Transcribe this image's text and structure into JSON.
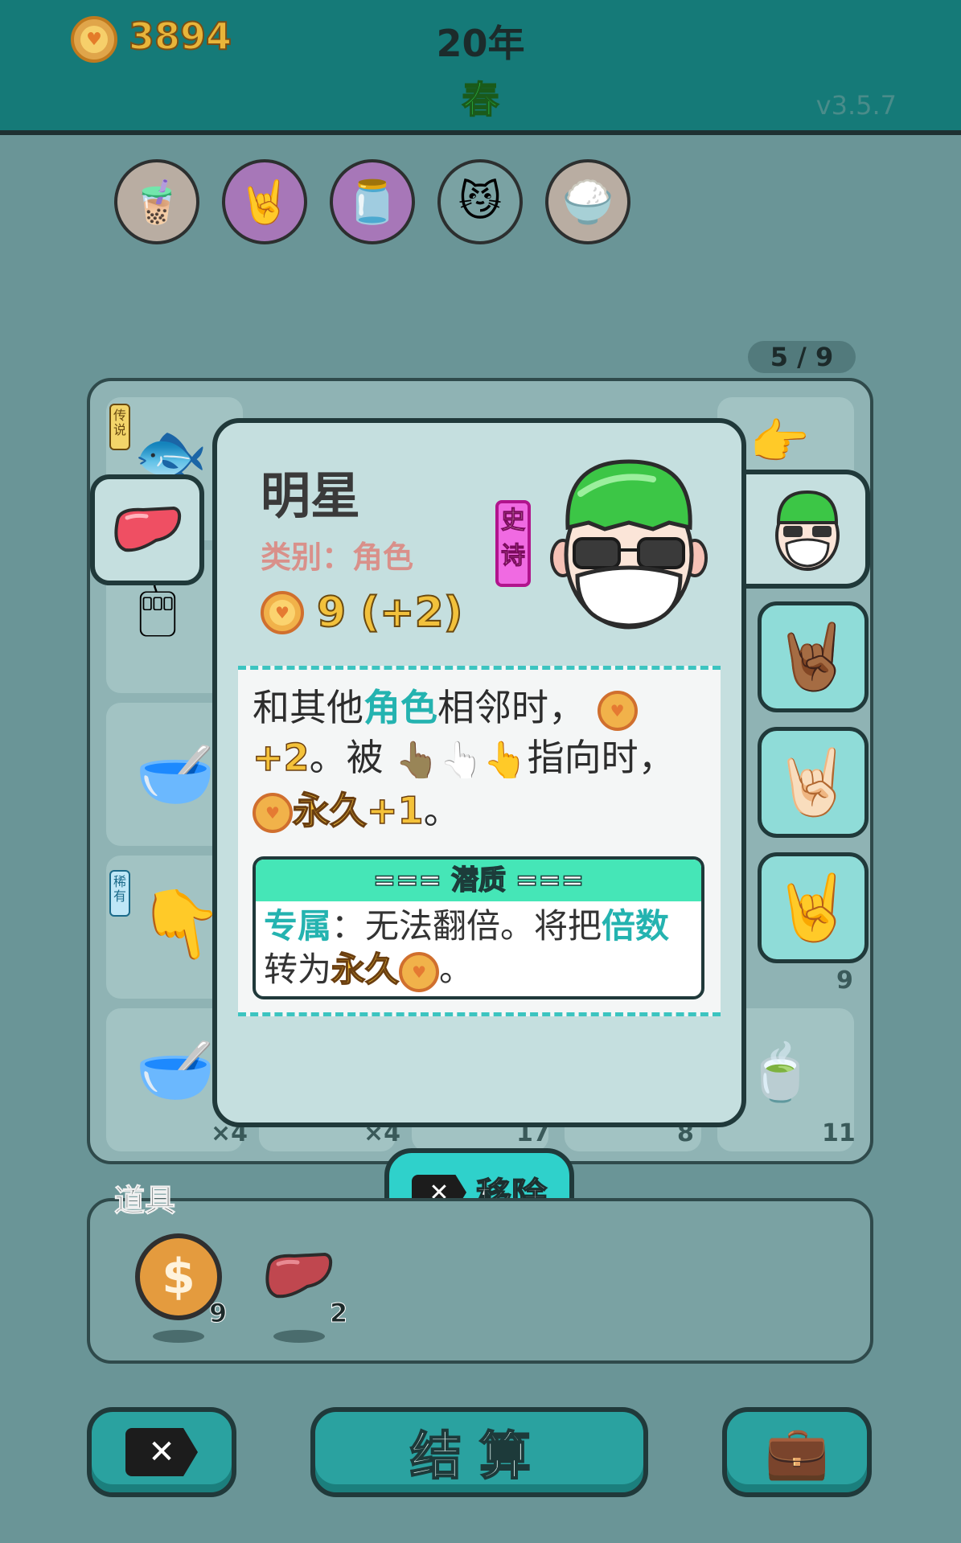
{
  "header": {
    "gold": "3894",
    "year": "20年",
    "season": "春",
    "version": "v3.5.7"
  },
  "relics": [
    {
      "icon": "bubble-tea-icon"
    },
    {
      "icon": "rock-hand-icon"
    },
    {
      "icon": "jar-icon"
    },
    {
      "icon": "cat-sunglasses-icon"
    },
    {
      "icon": "rice-bowl-icon"
    }
  ],
  "board": {
    "page": "5 / 9",
    "counts": [
      "×4",
      "×4",
      "17",
      "8",
      "11",
      "9"
    ],
    "rarity_legend": "传说",
    "rarity_rare": "稀有"
  },
  "card": {
    "title": "明星",
    "category": "类别：角色",
    "value": "9 (+2)",
    "rarity": "史诗",
    "desc_part1": "和其他",
    "desc_kw1": "角色",
    "desc_part2": "相邻时，",
    "desc_kw2": "+2",
    "desc_part3": "。被",
    "desc_part4": "指向时，",
    "desc_kw3": "永久+1",
    "desc_part5": "。",
    "trait_title": "=== 潜质 ===",
    "trait_kw1": "专属",
    "trait_part1": "：无法翻倍。将把",
    "trait_kw2": "倍数",
    "trait_part2": "转为",
    "trait_kw3": "永久",
    "trait_part3": "。"
  },
  "actions": {
    "remove": "移除",
    "settle": "结算"
  },
  "items": {
    "label": "道具",
    "coin_count": "9",
    "liver_count": "2"
  },
  "colors": {
    "topbar": "#157a78",
    "background": "#6a9597",
    "accent": "#2fd1cb",
    "epic": "#f06ae2"
  }
}
